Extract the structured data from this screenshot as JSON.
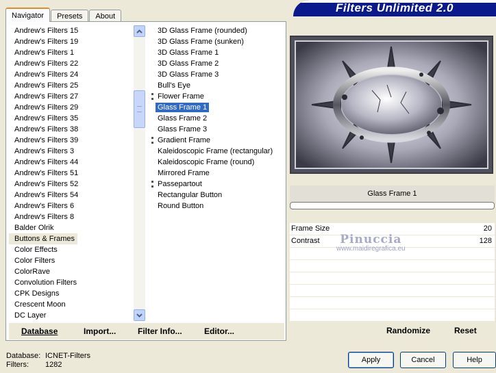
{
  "banner_title": "Filters Unlimited 2.0",
  "tabs": [
    {
      "label": "Navigator",
      "active": true
    },
    {
      "label": "Presets",
      "active": false
    },
    {
      "label": "About",
      "active": false
    }
  ],
  "categories": [
    "Andrew's Filters 15",
    "Andrew's Filters 19",
    "Andrew's Filters 1",
    "Andrew's Filters 22",
    "Andrew's Filters 24",
    "Andrew's Filters 25",
    "Andrew's Filters 27",
    "Andrew's Filters 29",
    "Andrew's Filters 35",
    "Andrew's Filters 38",
    "Andrew's Filters 39",
    "Andrew's Filters 3",
    "Andrew's Filters 44",
    "Andrew's Filters 51",
    "Andrew's Filters 52",
    "Andrew's Filters 54",
    "Andrew's Filters 6",
    "Andrew's Filters 8",
    "Balder Olrik",
    "Buttons & Frames",
    "Color Effects",
    "Color Filters",
    "ColorRave",
    "Convolution Filters",
    "CPK Designs",
    "Crescent Moon",
    "DC Layer"
  ],
  "selected_category": "Buttons & Frames",
  "filters": [
    {
      "label": "3D Glass Frame (rounded)",
      "grip": false
    },
    {
      "label": "3D Glass Frame (sunken)",
      "grip": false
    },
    {
      "label": "3D Glass Frame 1",
      "grip": false
    },
    {
      "label": "3D Glass Frame 2",
      "grip": false
    },
    {
      "label": "3D Glass Frame 3",
      "grip": false
    },
    {
      "label": "Bull's Eye",
      "grip": false
    },
    {
      "label": "Flower Frame",
      "grip": true
    },
    {
      "label": "Glass Frame 1",
      "grip": false
    },
    {
      "label": "Glass Frame 2",
      "grip": false
    },
    {
      "label": "Glass Frame 3",
      "grip": false
    },
    {
      "label": "Gradient Frame",
      "grip": true
    },
    {
      "label": "Kaleidoscopic Frame (rectangular)",
      "grip": false
    },
    {
      "label": "Kaleidoscopic Frame (round)",
      "grip": false
    },
    {
      "label": "Mirrored Frame",
      "grip": false
    },
    {
      "label": "Passepartout",
      "grip": true
    },
    {
      "label": "Rectangular Button",
      "grip": false
    },
    {
      "label": "Round Button",
      "grip": false
    }
  ],
  "selected_filter": "Glass Frame 1",
  "panel_buttons": {
    "database": "Database",
    "import": "Import...",
    "filter_info": "Filter Info...",
    "editor": "Editor..."
  },
  "preview": {
    "filter_name": "Glass Frame 1"
  },
  "parameters": [
    {
      "name": "Frame Size",
      "value": "20"
    },
    {
      "name": "Contrast",
      "value": "128"
    }
  ],
  "watermark": {
    "title": "Pinuccia",
    "url": "www.maidiregrafica.eu"
  },
  "right_buttons": {
    "randomize": "Randomize",
    "reset": "Reset"
  },
  "footer": {
    "database_label": "Database:",
    "database_value": "ICNET-Filters",
    "filters_label": "Filters:",
    "filters_value": "1282"
  },
  "dialog_buttons": {
    "apply": "Apply",
    "cancel": "Cancel",
    "help": "Help"
  }
}
